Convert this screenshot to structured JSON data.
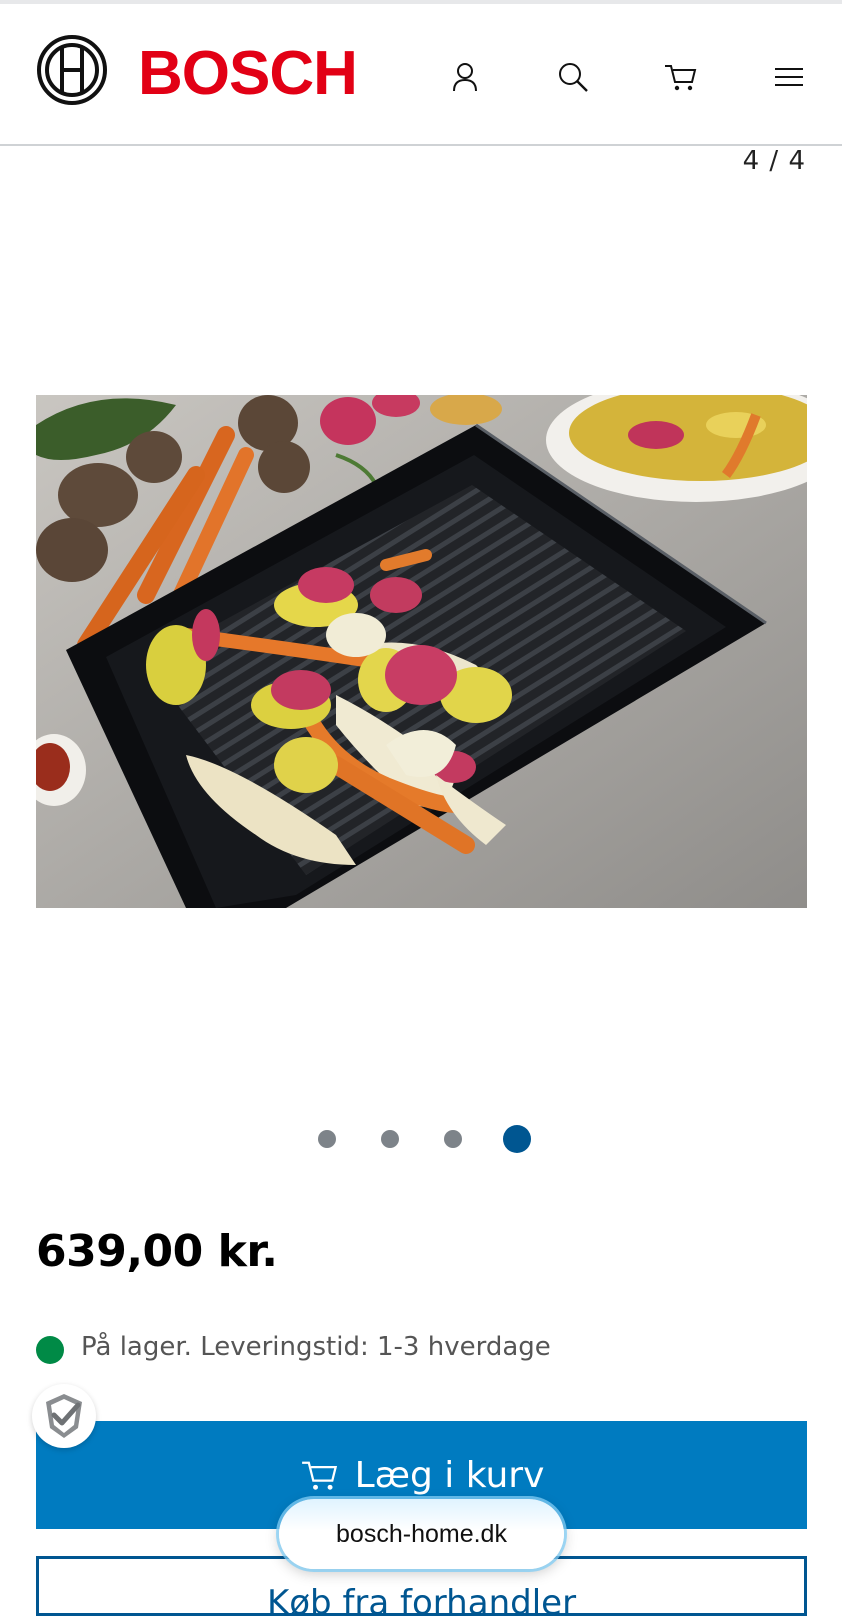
{
  "brand": {
    "name": "BOSCH",
    "color": "#e20015"
  },
  "header": {
    "icons": [
      "user-icon",
      "search-icon",
      "cart-icon",
      "menu-icon"
    ]
  },
  "gallery": {
    "counter": "4 / 4",
    "total": 4,
    "active": 4,
    "active_dot_color": "#005691"
  },
  "product": {
    "price": "639,00 kr.",
    "stock_text": "På lager. Leveringstid: 1-3 hverdage",
    "stock_color": "#008a46"
  },
  "actions": {
    "add_to_cart": "Læg i kurv",
    "add_to_cart_color": "#007bc0",
    "secondary": "Køb fra forhandler"
  },
  "browser": {
    "url": "bosch-home.dk"
  }
}
